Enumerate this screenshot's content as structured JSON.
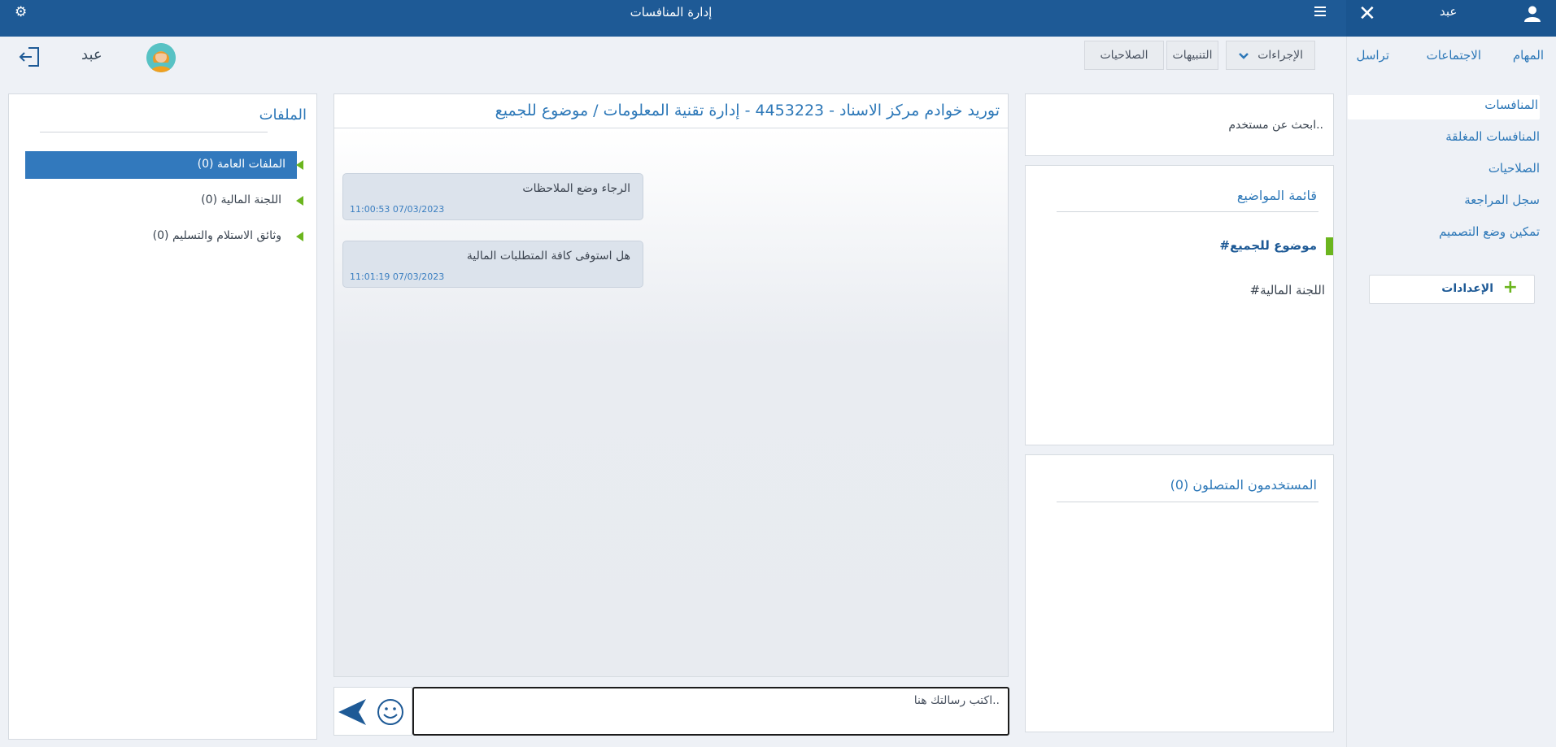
{
  "header": {
    "app_title": "إدارة المنافسات",
    "sidebar_user": "عبد"
  },
  "toolbar": {
    "user_name": "عبد",
    "actions_label": "الإجراءات",
    "alerts_label": "التنبيهات",
    "permissions_label": "الصلاحيات"
  },
  "sidebar": {
    "tabs": [
      "المهام",
      "الاجتماعات",
      "تراسل"
    ],
    "items": [
      "المنافسات",
      "المنافسات المغلقة",
      "الصلاحيات",
      "سجل المراجعة",
      "تمكين وضع التصميم"
    ],
    "active_item": "المنافسات",
    "settings_label": "الإعدادات"
  },
  "search": {
    "placeholder": "ابحث عن مستخدم.."
  },
  "topics": {
    "title": "قائمة المواضيع",
    "items": [
      "#موضوع للجميع",
      "#اللجنة المالية"
    ],
    "active": "#موضوع للجميع"
  },
  "connected": {
    "title": "المستخدمون المتصلون (0)"
  },
  "chat": {
    "title": "توريد خوادم مركز الاسناد - 4453223 - إدارة تقنية المعلومات / موضوع للجميع",
    "messages": [
      {
        "text": "الرجاء وضع الملاحظات",
        "time": "11:00:53 07/03/2023"
      },
      {
        "text": "هل استوفى كافة المتطلبات المالية",
        "time": "11:01:19 07/03/2023"
      }
    ],
    "input_placeholder": "اكتب رسالتك هنا.."
  },
  "files": {
    "title": "الملفات",
    "items": [
      "الملفات العامة (0)",
      "اللجنة المالية (0)",
      "وثائق الاستلام والتسليم (0)"
    ],
    "active": "الملفات العامة (0)"
  },
  "colors": {
    "header": "#1e5a96",
    "accent": "#2d78b8",
    "active_row": "#3279bd",
    "green": "#6bb51e"
  }
}
